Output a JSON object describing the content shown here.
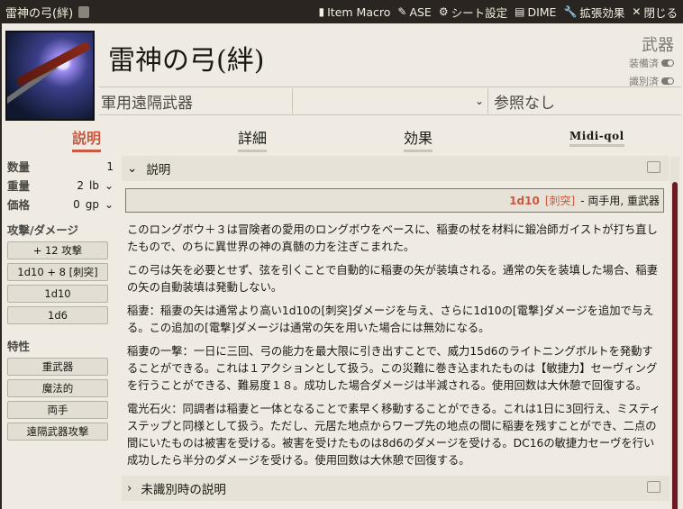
{
  "window": {
    "title": "雷神の弓(絆)",
    "actions": [
      {
        "icon": "document-icon",
        "label": "Item Macro"
      },
      {
        "icon": "pen-icon",
        "label": "ASE"
      },
      {
        "icon": "gear-icon",
        "label": "シート設定"
      },
      {
        "icon": "file-icon",
        "label": "DIME"
      },
      {
        "icon": "wrench-icon",
        "label": "拡張効果"
      },
      {
        "icon": "close-icon",
        "label": "閉じる"
      }
    ]
  },
  "header": {
    "name": "雷神の弓(絆)",
    "item_type": "武器",
    "equipped_label": "装備済",
    "identified_label": "識別済",
    "weapon_type": "軍用遠隔武器",
    "reference": "参照なし"
  },
  "tabs": [
    {
      "label": "説明",
      "active": true
    },
    {
      "label": "詳細",
      "active": false
    },
    {
      "label": "効果",
      "active": false
    },
    {
      "label": "Midi-qol",
      "active": false
    }
  ],
  "properties": {
    "quantity_label": "数量",
    "quantity": "1",
    "weight_label": "重量",
    "weight": "2",
    "weight_unit": "lb",
    "price_label": "価格",
    "price": "0",
    "price_unit": "gp"
  },
  "attack_section": {
    "title": "攻撃/ダメージ",
    "pills": [
      "+ 12 攻撃",
      "1d10 + 8 [刺突]",
      "1d10",
      "1d6"
    ]
  },
  "traits_section": {
    "title": "特性",
    "pills": [
      "重武器",
      "魔法的",
      "両手",
      "遠隔武器攻撃"
    ]
  },
  "description": {
    "section_title": "説明",
    "damage": "1d10",
    "damage_type": "[刺突]",
    "weapon_props": "- 両手用, 重武器",
    "paragraphs": [
      "このロングボウ＋３は冒険者の愛用のロングボウをベースに、稲妻の杖を材料に鍛冶師ガイストが打ち直したもので、のちに異世界の神の真髄の力を注ぎこまれた。",
      "この弓は矢を必要とせず、弦を引くことで自動的に稲妻の矢が装填される。通常の矢を装填した場合、稲妻の矢の自動装填は発動しない。",
      "稲妻：稲妻の矢は通常より高い1d10の[刺突]ダメージを与え、さらに1d10の[電撃]ダメージを追加で与える。この追加の[電撃]ダメージは通常の矢を用いた場合には無効になる。",
      "稲妻の一撃：一日に三回、弓の能力を最大限に引き出すことで、威力15d6のライトニングボルトを発動することができる。これは１アクションとして扱う。この災難に巻き込まれたものは【敏捷力】セーヴィングを行うことができる、難易度１８。成功した場合ダメージは半減される。使用回数は大休憩で回復する。",
      "電光石火：同調者は稲妻と一体となることで素早く移動することができる。これは1日に3回行え、ミスティステップと同様として扱う。ただし、元居た地点からワープ先の地点の間に稲妻を残すことができ、二点の間にいたものは被害を受ける。被害を受けたものは8d6のダメージを受ける。DC16の敏捷力セーヴを行い成功したら半分のダメージを受ける。使用回数は大休憩で回復する。"
    ],
    "next_section_title": "未識別時の説明"
  }
}
